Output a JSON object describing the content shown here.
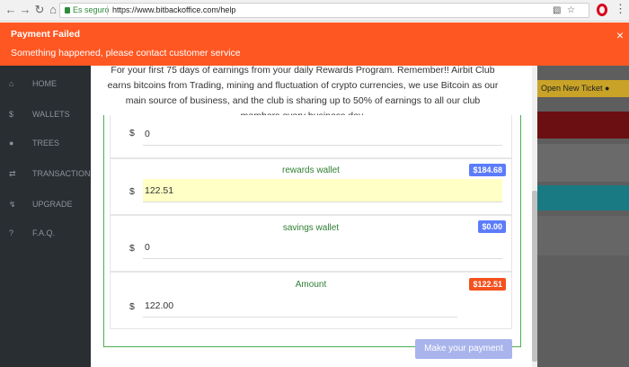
{
  "browser": {
    "secure_label": "Es seguro",
    "url": "https://www.bitbackoffice.com/help"
  },
  "alert": {
    "title": "Payment Failed",
    "message": "Something happened, please contact customer service",
    "color": "#ff5722"
  },
  "sidebar": {
    "items": [
      {
        "label": "HOME",
        "icon": "home-icon"
      },
      {
        "label": "WALLETS",
        "icon": "dollar-icon"
      },
      {
        "label": "TREES",
        "icon": "users-icon"
      },
      {
        "label": "TRANSACTIONS",
        "icon": "exchange-icon"
      },
      {
        "label": "UPGRADE",
        "icon": "flash-icon"
      },
      {
        "label": "F.A.Q.",
        "icon": "question-icon"
      }
    ]
  },
  "header": {
    "ticket_button": "Open New Ticket"
  },
  "modal": {
    "notice": "For your first 75 days of earnings from your daily Rewards Program. Remember!! Airbit Club earns bitcoins from Trading, mining and fluctuation of crypto currencies, we use Bitcoin as our main source of business, and the club is sharing up to 50% of earnings to all our club members every business day.",
    "currency_symbol": "$",
    "wallets": [
      {
        "title": "",
        "badge": "",
        "value": "0"
      },
      {
        "title": "rewards wallet",
        "badge": "$184.68",
        "value": "122.51",
        "badge_color": "#5c7cfa"
      },
      {
        "title": "savings wallet",
        "badge": "$0.00",
        "value": "0",
        "badge_color": "#5c7cfa"
      },
      {
        "title": "Amount",
        "badge": "$122.51",
        "value": "122.00",
        "badge_color": "#f4511e"
      }
    ],
    "pay_button": "Make your payment"
  }
}
